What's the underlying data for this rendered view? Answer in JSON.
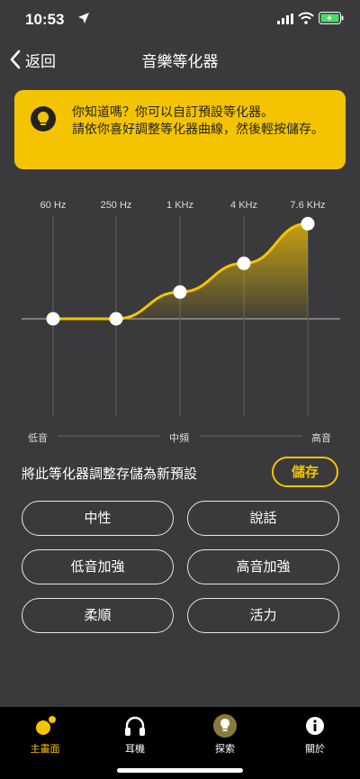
{
  "status": {
    "time": "10:53"
  },
  "nav": {
    "back_label": "返回",
    "title": "音樂等化器"
  },
  "tip": {
    "text": "你知道嗎？你可以自訂預設等化器。\n請依你喜好調整等化器曲線，然後輕按儲存。"
  },
  "eq": {
    "bands": [
      {
        "freq": "60 Hz",
        "level": 0
      },
      {
        "freq": "250 Hz",
        "level": 0
      },
      {
        "freq": "1 KHz",
        "level": 27
      },
      {
        "freq": "4 KHz",
        "level": 56
      },
      {
        "freq": "7.6 KHz",
        "level": 96
      }
    ],
    "range": {
      "low": "低音",
      "mid": "中頻",
      "high": "高音"
    }
  },
  "save": {
    "label": "將此等化器調整存儲為新預設",
    "button": "儲存"
  },
  "presets": [
    "中性",
    "說話",
    "低音加強",
    "高音加強",
    "柔順",
    "活力"
  ],
  "tabs": [
    {
      "label": "主畫面",
      "icon": "home-icon",
      "active": true
    },
    {
      "label": "耳機",
      "icon": "headphones-icon",
      "active": false
    },
    {
      "label": "探索",
      "icon": "explore-icon",
      "active": false
    },
    {
      "label": "關於",
      "icon": "info-icon",
      "active": false
    }
  ],
  "colors": {
    "accent": "#f5c400",
    "background": "#3a3a3c"
  }
}
